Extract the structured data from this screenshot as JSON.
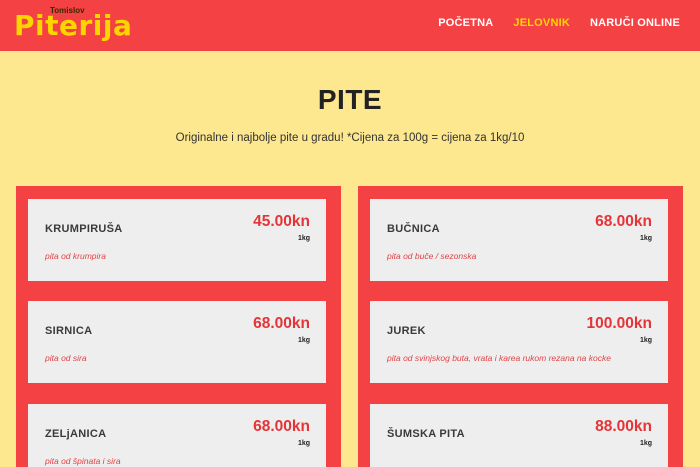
{
  "brand": {
    "top_text": "Tomislov",
    "name": "Piterija"
  },
  "nav": [
    {
      "label": "POČETNA",
      "active": false
    },
    {
      "label": "JELOVNIK",
      "active": true
    },
    {
      "label": "NARUČI ONLINE",
      "active": false
    }
  ],
  "page": {
    "title": "PITE",
    "subtitle": "Originalne i najbolje pite u gradu! *Cijena za 100g = cijena za 1kg/10"
  },
  "menu_left": [
    {
      "name": "KRUMPIRUŠA",
      "price": "45.00kn",
      "unit": "1kg",
      "desc": "pita od krumpira"
    },
    {
      "name": "SIRNICA",
      "price": "68.00kn",
      "unit": "1kg",
      "desc": "pita od sira"
    },
    {
      "name": "ZELjANICA",
      "price": "68.00kn",
      "unit": "1kg",
      "desc": "pita od špinata i sira"
    }
  ],
  "menu_right": [
    {
      "name": "BUČNICA",
      "price": "68.00kn",
      "unit": "1kg",
      "desc": "pita od buče / sezonska"
    },
    {
      "name": "JUREK",
      "price": "100.00kn",
      "unit": "1kg",
      "desc": "pita od svinjskog buta, vrata i karea rukom rezana na kocke"
    },
    {
      "name": "ŠUMSKA PITA",
      "price": "88.00kn",
      "unit": "1kg",
      "desc": ""
    }
  ],
  "colors": {
    "header": "#f44143",
    "background": "#fde78f",
    "accent": "#fcd500",
    "price": "#e53438",
    "card": "#eeeeee"
  }
}
